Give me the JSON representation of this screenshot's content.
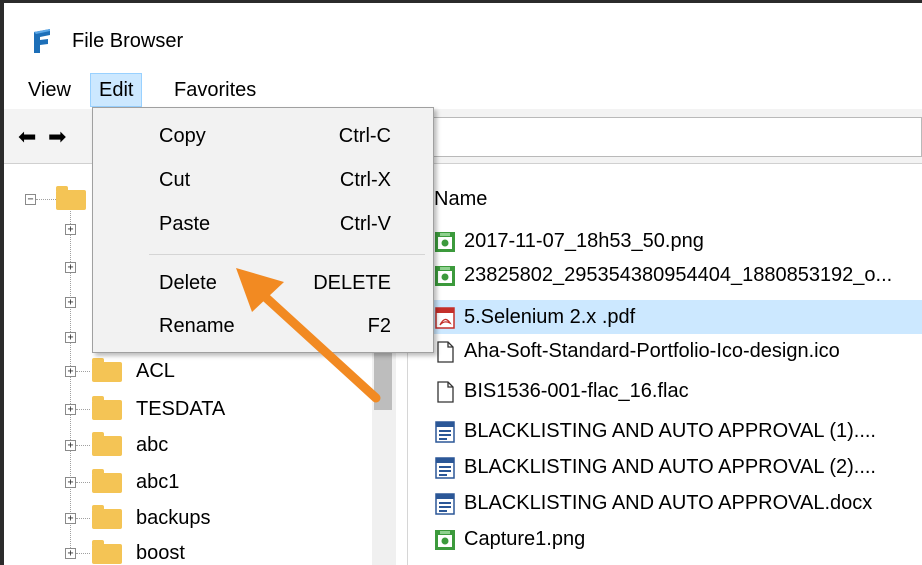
{
  "app": {
    "title": "File Browser"
  },
  "menu": {
    "view": "View",
    "edit": "Edit",
    "favorites": "Favorites"
  },
  "edit_menu": {
    "items": [
      {
        "label": "Copy",
        "shortcut": "Ctrl-C"
      },
      {
        "label": "Cut",
        "shortcut": "Ctrl-X"
      },
      {
        "label": "Paste",
        "shortcut": "Ctrl-V"
      },
      {
        "label": "Delete",
        "shortcut": "DELETE"
      },
      {
        "label": "Rename",
        "shortcut": "F2"
      }
    ]
  },
  "tree": {
    "folders": [
      {
        "name": "ACL"
      },
      {
        "name": "TESDATA"
      },
      {
        "name": "abc"
      },
      {
        "name": "abc1"
      },
      {
        "name": "backups"
      },
      {
        "name": "boost"
      }
    ]
  },
  "file_list": {
    "header": "Name",
    "files": [
      {
        "name": "2017-11-07_18h53_50.png",
        "icon": "image-file-icon"
      },
      {
        "name": "23825802_295354380954404_1880853192_o...",
        "icon": "image-file-icon"
      },
      {
        "name": "5.Selenium 2.x .pdf",
        "icon": "pdf-file-icon",
        "selected": true
      },
      {
        "name": "Aha-Soft-Standard-Portfolio-Ico-design.ico",
        "icon": "generic-file-icon"
      },
      {
        "name": "BIS1536-001-flac_16.flac",
        "icon": "generic-file-icon"
      },
      {
        "name": "BLACKLISTING AND AUTO APPROVAL (1)....",
        "icon": "docx-file-icon"
      },
      {
        "name": "BLACKLISTING AND AUTO APPROVAL (2)....",
        "icon": "docx-file-icon"
      },
      {
        "name": "BLACKLISTING AND AUTO APPROVAL.docx",
        "icon": "docx-file-icon"
      },
      {
        "name": "Capture1.png",
        "icon": "image-file-icon"
      }
    ]
  },
  "colors": {
    "selection": "#cce8ff",
    "folder": "#f4c455",
    "annotation_arrow": "#f28a22"
  }
}
